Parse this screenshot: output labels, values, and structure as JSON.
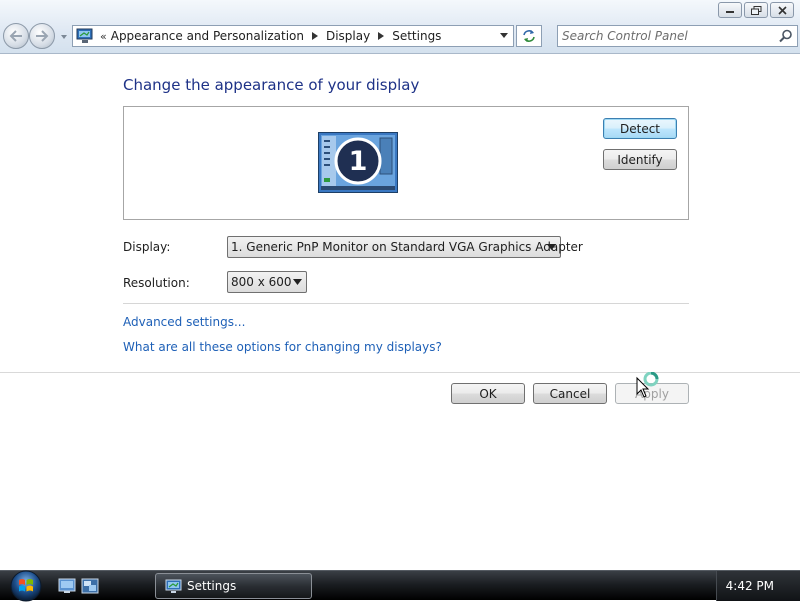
{
  "window": {
    "caption_buttons": [
      "minimize-icon",
      "maximize-icon",
      "close-icon"
    ]
  },
  "address_bar": {
    "overflow": "«",
    "breadcrumbs": [
      "Appearance and Personalization",
      "Display",
      "Settings"
    ]
  },
  "search": {
    "placeholder": "Search Control Panel"
  },
  "main": {
    "title": "Change the appearance of your display",
    "monitor_number": "1",
    "detect_label": "Detect",
    "identify_label": "Identify",
    "display_label": "Display:",
    "display_value": "1. Generic PnP Monitor on Standard VGA Graphics Adapter",
    "resolution_label": "Resolution:",
    "resolution_value": "800 x 600",
    "links": [
      "Advanced settings...",
      "What are all these options for changing my displays?"
    ]
  },
  "footer_buttons": {
    "ok": "OK",
    "cancel": "Cancel",
    "apply": "Apply"
  },
  "taskbar": {
    "task_label": "Settings",
    "clock": "4:42 PM"
  },
  "colors": {
    "title": "#1e3287",
    "link": "#1e60b7",
    "taskbar": "#1b1e22"
  }
}
